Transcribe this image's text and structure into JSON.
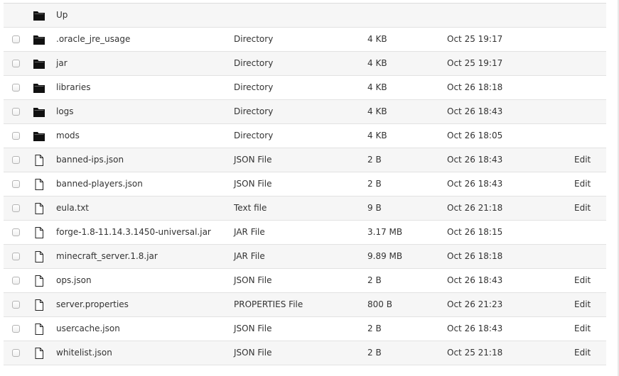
{
  "file_list": {
    "up_row": {
      "name": "Up",
      "icon": "folder-icon"
    },
    "rows": [
      {
        "name": ".oracle_jre_usage",
        "type": "Directory",
        "size": "4 KB",
        "modified": "Oct 25 19:17",
        "edit": "",
        "icon": "folder-icon"
      },
      {
        "name": "jar",
        "type": "Directory",
        "size": "4 KB",
        "modified": "Oct 25 19:17",
        "edit": "",
        "icon": "folder-icon"
      },
      {
        "name": "libraries",
        "type": "Directory",
        "size": "4 KB",
        "modified": "Oct 26 18:18",
        "edit": "",
        "icon": "folder-icon"
      },
      {
        "name": "logs",
        "type": "Directory",
        "size": "4 KB",
        "modified": "Oct 26 18:43",
        "edit": "",
        "icon": "folder-icon"
      },
      {
        "name": "mods",
        "type": "Directory",
        "size": "4 KB",
        "modified": "Oct 26 18:05",
        "edit": "",
        "icon": "folder-icon"
      },
      {
        "name": "banned-ips.json",
        "type": "JSON File",
        "size": "2 B",
        "modified": "Oct 26 18:43",
        "edit": "Edit",
        "icon": "file-icon"
      },
      {
        "name": "banned-players.json",
        "type": "JSON File",
        "size": "2 B",
        "modified": "Oct 26 18:43",
        "edit": "Edit",
        "icon": "file-icon"
      },
      {
        "name": "eula.txt",
        "type": "Text file",
        "size": "9 B",
        "modified": "Oct 26 21:18",
        "edit": "Edit",
        "icon": "file-icon"
      },
      {
        "name": "forge-1.8-11.14.3.1450-universal.jar",
        "type": "JAR File",
        "size": "3.17 MB",
        "modified": "Oct 26 18:15",
        "edit": "",
        "icon": "file-icon"
      },
      {
        "name": "minecraft_server.1.8.jar",
        "type": "JAR File",
        "size": "9.89 MB",
        "modified": "Oct 26 18:18",
        "edit": "",
        "icon": "file-icon"
      },
      {
        "name": "ops.json",
        "type": "JSON File",
        "size": "2 B",
        "modified": "Oct 26 18:43",
        "edit": "Edit",
        "icon": "file-icon"
      },
      {
        "name": "server.properties",
        "type": "PROPERTIES File",
        "size": "800 B",
        "modified": "Oct 26 21:23",
        "edit": "Edit",
        "icon": "file-icon"
      },
      {
        "name": "usercache.json",
        "type": "JSON File",
        "size": "2 B",
        "modified": "Oct 26 18:43",
        "edit": "Edit",
        "icon": "file-icon"
      },
      {
        "name": "whitelist.json",
        "type": "JSON File",
        "size": "2 B",
        "modified": "Oct 25 21:18",
        "edit": "Edit",
        "icon": "file-icon"
      }
    ]
  },
  "colors": {
    "row_stripe": "#f6f6f6",
    "row_divider": "#e2e2e2",
    "text": "#333333",
    "folder_icon": "#111111"
  }
}
